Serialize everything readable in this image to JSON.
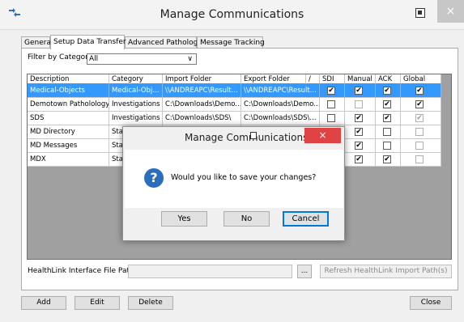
{
  "window": {
    "title": "Manage Communications",
    "close_glyph": "×"
  },
  "tabs": [
    {
      "label": "General"
    },
    {
      "label": "Setup Data Transfer"
    },
    {
      "label": "Advanced Pathology"
    },
    {
      "label": "Message Tracking"
    }
  ],
  "filter": {
    "label": "Filter by Category",
    "value": "All"
  },
  "grid": {
    "columns": [
      "Description",
      "Category",
      "Import Folder",
      "Export Folder",
      "/",
      "SDI",
      "Manual",
      "ACK",
      "Global"
    ],
    "rows": [
      {
        "description": "Medical-Objects",
        "category": "Medical-Obj...",
        "import": "\\\\ANDREAPC\\Result...",
        "export": "\\\\ANDREAPC\\Result...",
        "sdi": true,
        "manual": true,
        "ack": true,
        "global": true,
        "selected": true
      },
      {
        "description": "Demotown Patholology",
        "category": "Investigations",
        "import": "C:\\Downloads\\Demo...",
        "export": "C:\\Downloads\\Demo...",
        "sdi": false,
        "manual": false,
        "ack": true,
        "global": true,
        "selected": false
      },
      {
        "description": "SDS",
        "category": "Investigations",
        "import": "C:\\Downloads\\SDS\\",
        "export": "C:\\Downloads\\SDS\\...",
        "sdi": false,
        "manual": true,
        "ack": true,
        "global": true,
        "global_dim": true,
        "selected": false
      },
      {
        "description": "MD Directory",
        "category": "Sta",
        "import": "",
        "export": "",
        "sdi": null,
        "manual": true,
        "ack": false,
        "global": false,
        "selected": false
      },
      {
        "description": "MD Messages",
        "category": "Sta",
        "import": "",
        "export": "",
        "sdi": null,
        "manual": true,
        "ack": false,
        "global": false,
        "selected": false
      },
      {
        "description": "MDX",
        "category": "Sta",
        "import": "",
        "export": "",
        "sdi": null,
        "manual": true,
        "ack": true,
        "global": false,
        "selected": false
      }
    ]
  },
  "healthlink": {
    "label": "HealthLink Interface File Path",
    "value": "",
    "browse_label": "...",
    "refresh_label": "Refresh HealthLink Import Path(s)"
  },
  "buttons": {
    "add": "Add",
    "edit": "Edit",
    "delete": "Delete",
    "close": "Close"
  },
  "dialog": {
    "title": "Manage Communications",
    "close_glyph": "×",
    "icon_glyph": "?",
    "message": "Would you like to save your changes?",
    "yes": "Yes",
    "no": "No",
    "cancel": "Cancel"
  },
  "colors": {
    "selection": "#3399ff",
    "dialog_close": "#e04343",
    "question_icon": "#2a6ebd"
  }
}
